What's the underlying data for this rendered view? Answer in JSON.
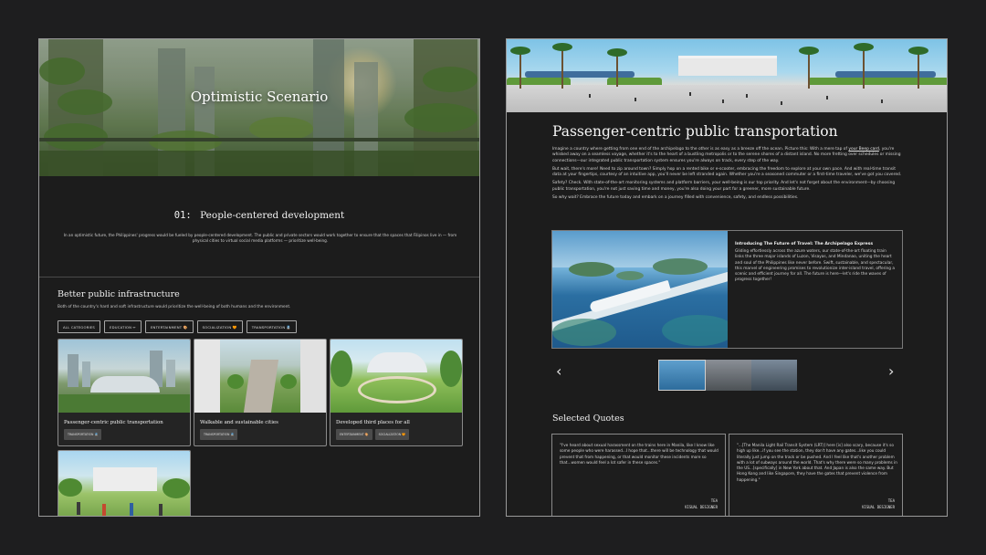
{
  "left": {
    "hero_title": "Optimistic Scenario",
    "section_number": "01:",
    "section_title": "People-centered development",
    "section_description": "In an optimistic future, the Philippines' progress would be fueled by people-centered development. The public and private sectors would work together to ensure that the spaces that Filipinos live in — from physical cities to virtual social media platforms — prioritize well-being.",
    "sub_title": "Better public infrastructure",
    "sub_description": "Both of the country's hard and soft infrastructure would prioritize the well-being of both humans and the environment.",
    "filters": [
      {
        "label": "ALL CATEGORIES"
      },
      {
        "label": "EDUCATION ✏"
      },
      {
        "label": "ENTERTAINMENT 🎨"
      },
      {
        "label": "SOCIALIZATION 🧡"
      },
      {
        "label": "TRANSPORTATION 🚆"
      }
    ],
    "cards": [
      {
        "title": "Passenger-centric public transportation",
        "tags": [
          "TRANSPORTATION 🚆"
        ]
      },
      {
        "title": "Walkable and sustainable cities",
        "tags": [
          "TRANSPORTATION 🚆"
        ]
      },
      {
        "title": "Developed third places for all",
        "tags": [
          "ENTERTAINMENT 🎨",
          "SOCIALIZATION 🧡"
        ]
      }
    ]
  },
  "right": {
    "title": "Passenger-centric public transportation",
    "paragraphs": [
      {
        "before": "Imagine a country where getting from one end of the archipelago to the other is as easy as a breeze off the ocean. Picture this: With a mere tap of ",
        "link": "your Beep card",
        "after": ", you're whisked away on a seamless voyage, whether it's to the heart of a bustling metropolis or to the serene shores of a distant island. No more fretting over schedules or missing connections—our integrated public transportation system ensures you're always on track, every step of the way."
      },
      {
        "before": "But wait, there's more! Need to zip around town? Simply hop on a rented bike or e-scooter, embracing the freedom to explore at your own pace. And with real-time transit data at your fingertips, courtesy of an intuitive app, you'll never be left stranded again. Whether you're a seasoned commuter or a first-time traveler, we've got you covered.",
        "link": "",
        "after": ""
      },
      {
        "before": "Safety? Check. With state-of-the-art monitoring systems and platform barriers, your well-being is our top priority. And let's not forget about the environment—by choosing public transportation, you're not just saving time and money, you're also doing your part for a greener, more sustainable future.",
        "link": "",
        "after": ""
      },
      {
        "before": "So why wait? Embrace the future today and embark on a journey filled with convenience, safety, and endless possibilities.",
        "link": "",
        "after": ""
      }
    ],
    "feature_title": "Introducing The Future of Travel: The Archipelago Express",
    "feature_text": "Gliding effortlessly across the azure waters, our state-of-the-art floating train links the three major islands of Luzon, Visayas, and Mindanao, uniting the heart and soul of the Philippines like never before. Swift, sustainable, and spectacular, this marvel of engineering promises to revolutionize inter-island travel, offering a scenic and efficient journey for all. The future is here—let's ride the waves of progress together!",
    "prev_arrow": "‹",
    "next_arrow": "›",
    "quotes_heading": "Selected Quotes",
    "quotes": [
      {
        "text": "\"I've heard about sexual harassment on the trains here in Manila, like I know like some people who were harassed...I hope that...there will be technology that would prevent that from happening, or that would monitor these incidents more so that...women would feel a lot safer in these spaces.\"",
        "name": "TEA",
        "role": "VISUAL DESIGNER"
      },
      {
        "text": "\"...[The Manila Light Rail Transit System (LRT)] here [is] also scary, because it's so high up like...if you see the station, they don't have any gates...like you could literally just jump on the track or be pushed. And I feel like that's another problem with a lot of subways around the world. That's why there were so many problems in the US...[specifically] in New York about that. And Japan is also the same way. But Hong Kong and like Singapore, they have the gates that prevent violence from happening.\"",
        "name": "TEA",
        "role": "VISUAL DESIGNER"
      }
    ]
  }
}
